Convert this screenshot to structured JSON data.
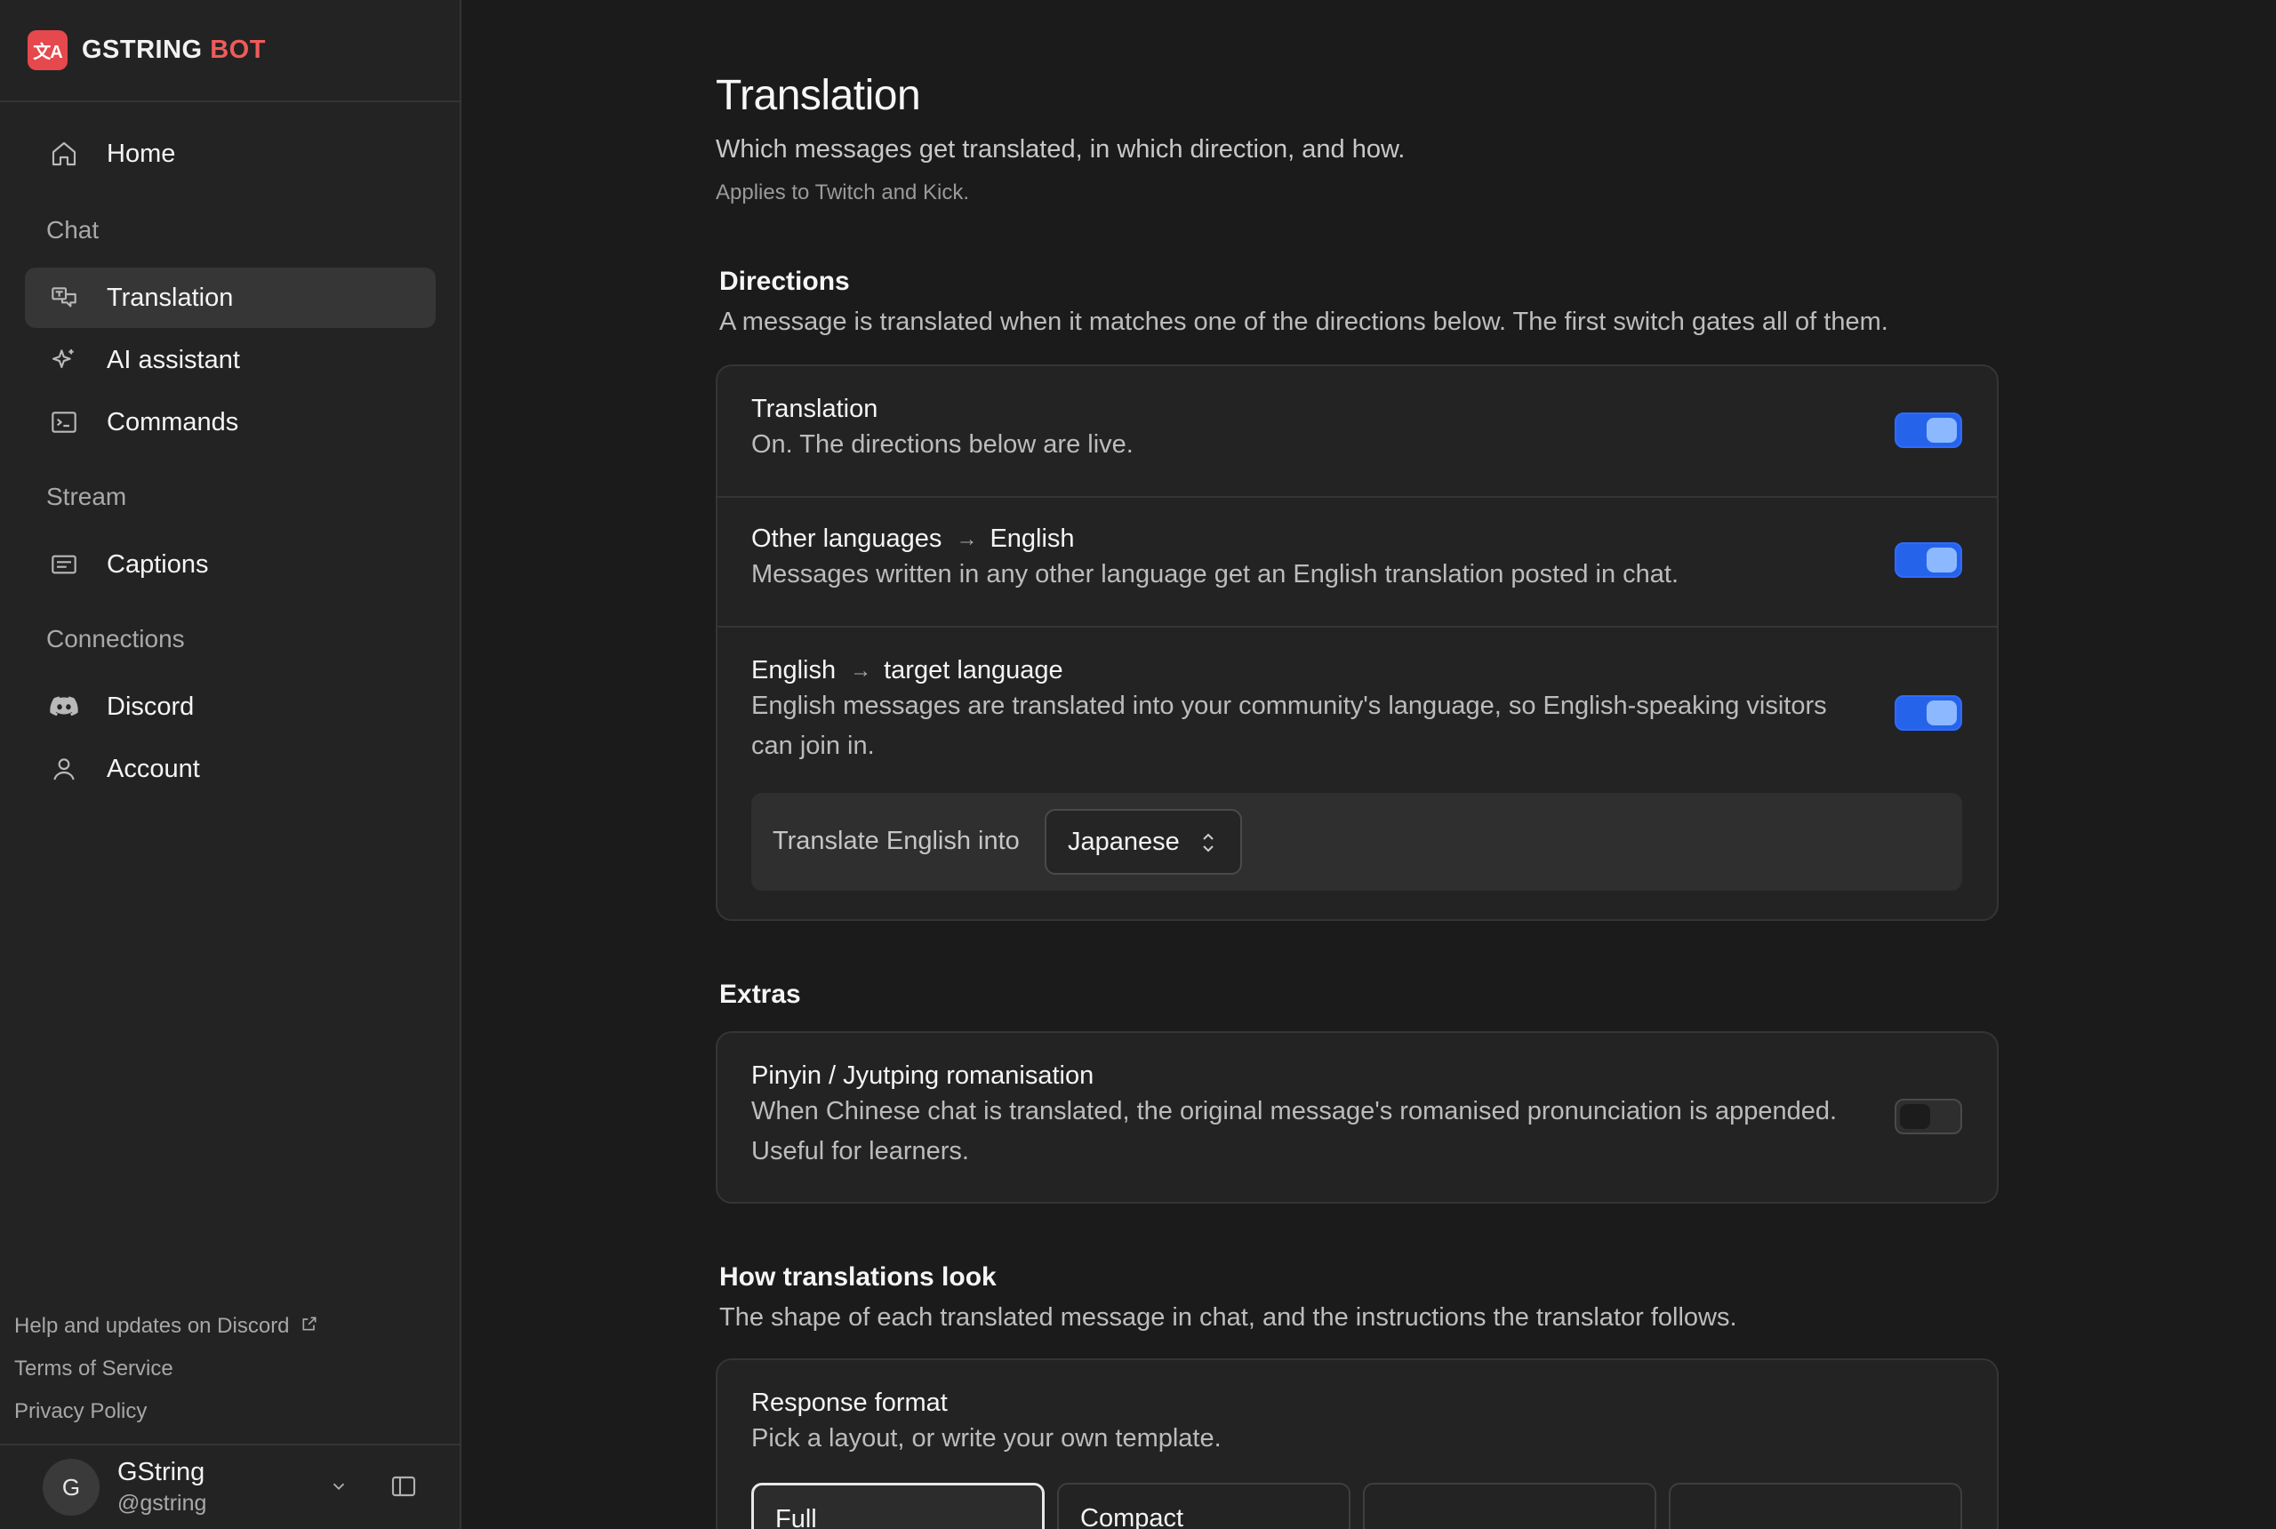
{
  "brand": {
    "logo_text": "文A",
    "name_main": "GSTRING",
    "name_accent": "BOT"
  },
  "nav": {
    "home": "Home",
    "section_chat": "Chat",
    "translation": "Translation",
    "ai_assistant": "AI assistant",
    "commands": "Commands",
    "section_stream": "Stream",
    "captions": "Captions",
    "section_connections": "Connections",
    "discord": "Discord",
    "account": "Account"
  },
  "footer": {
    "help": "Help and updates on Discord",
    "terms": "Terms of Service",
    "privacy": "Privacy Policy"
  },
  "user": {
    "initial": "G",
    "name": "GString",
    "handle": "@gstring"
  },
  "page": {
    "title": "Translation",
    "subtitle": "Which messages get translated, in which direction, and how.",
    "note": "Applies to Twitch and Kick."
  },
  "directions": {
    "title": "Directions",
    "desc": "A message is translated when it matches one of the directions below. The first switch gates all of them.",
    "rows": [
      {
        "title": "Translation",
        "desc": "On. The directions below are live.",
        "enabled": true
      },
      {
        "from": "Other languages",
        "to": "English",
        "desc": "Messages written in any other language get an English translation posted in chat.",
        "enabled": true
      },
      {
        "from": "English",
        "to": "target language",
        "desc": "English messages are translated into your community's language, so English-speaking visitors can join in.",
        "enabled": true
      }
    ],
    "target_label": "Translate English into",
    "target_value": "Japanese"
  },
  "extras": {
    "title": "Extras",
    "rows": [
      {
        "title": "Pinyin / Jyutping romanisation",
        "desc": "When Chinese chat is translated, the original message's romanised pronunciation is appended. Useful for learners.",
        "enabled": false
      }
    ]
  },
  "look": {
    "title": "How translations look",
    "desc": "The shape of each translated message in chat, and the instructions the translator follows.",
    "format_title": "Response format",
    "format_desc": "Pick a layout, or write your own template.",
    "formats": [
      "Full",
      "Compact",
      "",
      ""
    ],
    "selected_format": "Full"
  },
  "colors": {
    "accent": "#2563eb",
    "brand": "#e5484d",
    "background": "#1b1b1b",
    "sidebar": "#232323"
  },
  "icons": [
    "home-icon",
    "translate-icon",
    "sparkle-icon",
    "terminal-icon",
    "captions-icon",
    "discord-icon",
    "user-icon",
    "external-link-icon",
    "chevron-down-icon",
    "sidebar-toggle-icon",
    "updown-chevron-icon",
    "arrow-right-icon"
  ]
}
